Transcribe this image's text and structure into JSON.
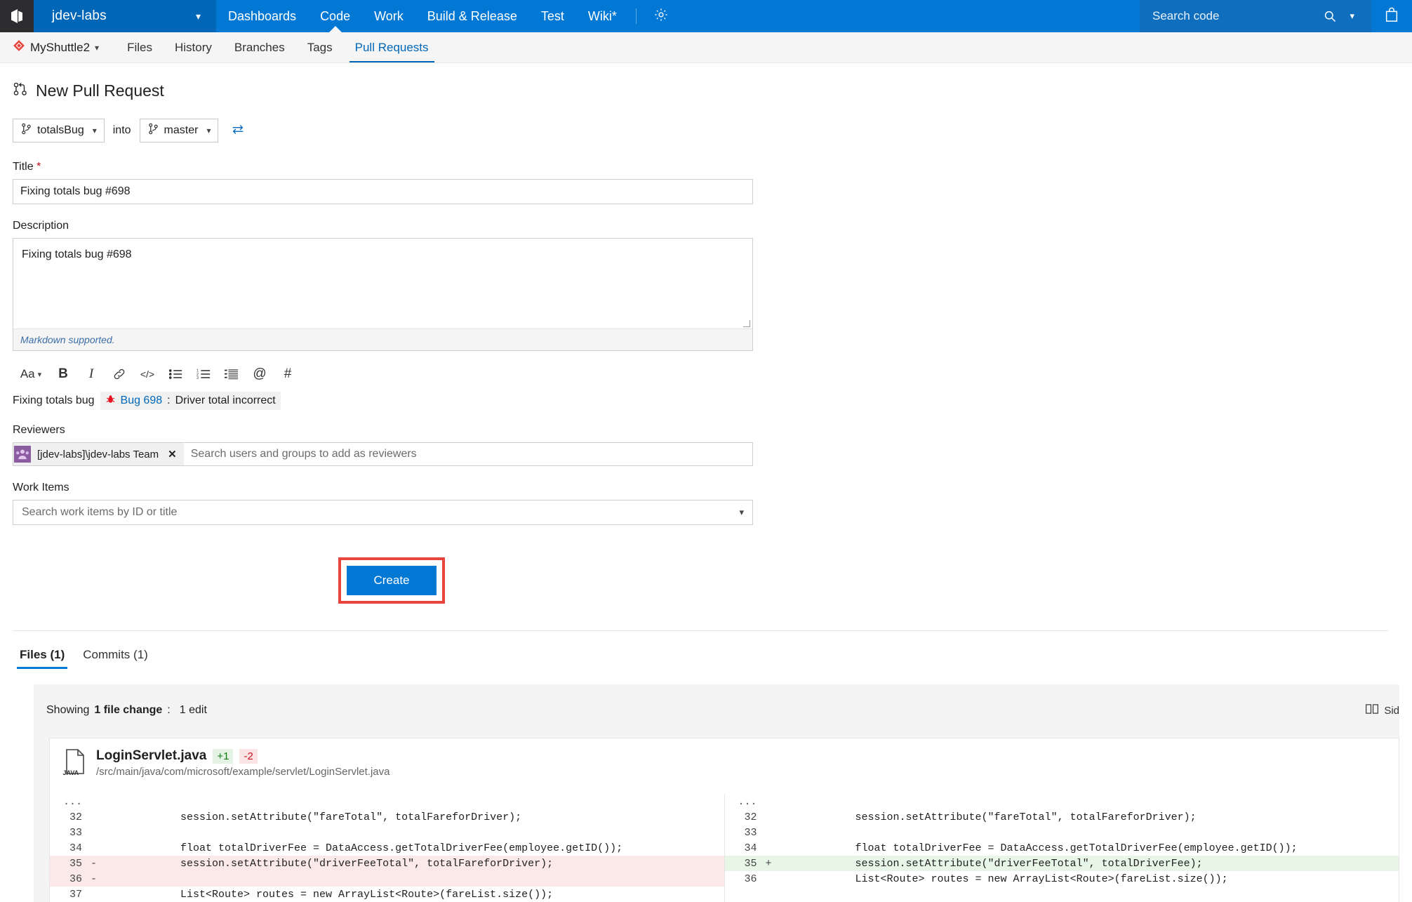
{
  "topbar": {
    "logo_icon": "azure-devops-logo-icon",
    "account": "jdev-labs",
    "account_chevron_icon": "chevron-down-icon",
    "nav": [
      {
        "label": "Dashboards",
        "selected": false
      },
      {
        "label": "Code",
        "selected": true
      },
      {
        "label": "Work",
        "selected": false
      },
      {
        "label": "Build & Release",
        "selected": false
      },
      {
        "label": "Test",
        "selected": false
      },
      {
        "label": "Wiki*",
        "selected": false
      }
    ],
    "gear_icon": "gear-icon",
    "search_placeholder": "Search code",
    "search_icon": "search-icon",
    "search_chevron_icon": "chevron-down-icon",
    "cart_icon": "shopping-bag-icon",
    "accent_color": "#0078d4"
  },
  "subnav": {
    "repo_icon": "git-repository-icon",
    "repo_name": "MyShuttle2",
    "repo_chevron_icon": "chevron-down-icon",
    "items": [
      {
        "label": "Files",
        "selected": false
      },
      {
        "label": "History",
        "selected": false
      },
      {
        "label": "Branches",
        "selected": false
      },
      {
        "label": "Tags",
        "selected": false
      },
      {
        "label": "Pull Requests",
        "selected": true
      }
    ]
  },
  "page": {
    "title": "New Pull Request",
    "title_icon": "pull-request-icon"
  },
  "branches": {
    "source_icon": "branch-icon",
    "source": "totalsBug",
    "source_chevron_icon": "chevron-down-icon",
    "into_label": "into",
    "target_icon": "branch-icon",
    "target": "master",
    "target_chevron_icon": "chevron-down-icon",
    "swap_icon": "swap-arrows-icon"
  },
  "form": {
    "title_label": "Title",
    "title_required_marker": "*",
    "title_value": "Fixing totals bug #698",
    "description_label": "Description",
    "description_value": "Fixing totals bug #698",
    "markdown_note": "Markdown supported.",
    "reviewers_label": "Reviewers",
    "reviewer_chip": "[jdev-labs]\\jdev-labs Team",
    "reviewer_avatar_icon": "group-avatar-icon",
    "reviewer_remove_icon": "close-x-icon",
    "reviewers_placeholder": "Search users and groups to add as reviewers",
    "work_items_label": "Work Items",
    "work_items_placeholder": "Search work items by ID or title",
    "work_items_chevron_icon": "chevron-down-icon"
  },
  "markdown_toolbar": [
    {
      "label": "Aa",
      "icon": "font-size-icon"
    },
    {
      "label": "B",
      "icon": "bold-icon"
    },
    {
      "label": "I",
      "icon": "italic-icon"
    },
    {
      "label": "",
      "icon": "link-icon"
    },
    {
      "label": "</>",
      "icon": "code-icon"
    },
    {
      "label": "",
      "icon": "bullet-list-icon"
    },
    {
      "label": "",
      "icon": "numbered-list-icon"
    },
    {
      "label": "",
      "icon": "task-list-icon"
    },
    {
      "label": "@",
      "icon": "mention-icon"
    },
    {
      "label": "#",
      "icon": "work-item-link-icon"
    }
  ],
  "bug_reference": {
    "prefix_text": "Fixing totals bug",
    "bug_icon": "bug-icon",
    "bug_id": "Bug 698",
    "separator": ":",
    "bug_title": "Driver total incorrect"
  },
  "create": {
    "label": "Create",
    "highlight_color": "#e8453c",
    "button_color": "#0078d4"
  },
  "tabs": [
    {
      "label": "Files (1)",
      "selected": true
    },
    {
      "label": "Commits (1)",
      "selected": false
    }
  ],
  "diff": {
    "showing_prefix": "Showing",
    "showing_count": "1 file change",
    "showing_suffix": ":",
    "edit_summary": "1 edit",
    "side_by_side_icon": "side-by-side-icon",
    "side_by_side_label": "Sid",
    "file_icon": "java-file-icon",
    "file_name": "LoginServlet.java",
    "additions": "+1",
    "deletions": "-2",
    "file_path": "/src/main/java/com/microsoft/example/servlet/LoginServlet.java",
    "ellipsis": "...",
    "left_lines": [
      {
        "num": "32",
        "sign": "",
        "code": "            session.setAttribute(\"fareTotal\", totalFareforDriver);",
        "type": "context"
      },
      {
        "num": "33",
        "sign": "",
        "code": "",
        "type": "context"
      },
      {
        "num": "34",
        "sign": "",
        "code": "            float totalDriverFee = DataAccess.getTotalDriverFee(employee.getID());",
        "type": "context"
      },
      {
        "num": "35",
        "sign": "-",
        "code": "            session.setAttribute(\"driverFeeTotal\", totalFareforDriver);",
        "type": "delete"
      },
      {
        "num": "36",
        "sign": "-",
        "code": "",
        "type": "delete"
      },
      {
        "num": "37",
        "sign": "",
        "code": "            List<Route> routes = new ArrayList<Route>(fareList.size());",
        "type": "context"
      }
    ],
    "right_lines": [
      {
        "num": "32",
        "sign": "",
        "code": "            session.setAttribute(\"fareTotal\", totalFareforDriver);",
        "type": "context"
      },
      {
        "num": "33",
        "sign": "",
        "code": "",
        "type": "context"
      },
      {
        "num": "34",
        "sign": "",
        "code": "            float totalDriverFee = DataAccess.getTotalDriverFee(employee.getID());",
        "type": "context"
      },
      {
        "num": "35",
        "sign": "+",
        "code": "            session.setAttribute(\"driverFeeTotal\", totalDriverFee);",
        "type": "add"
      },
      {
        "num": "36",
        "sign": "",
        "code": "            List<Route> routes = new ArrayList<Route>(fareList.size());",
        "type": "context"
      }
    ]
  }
}
